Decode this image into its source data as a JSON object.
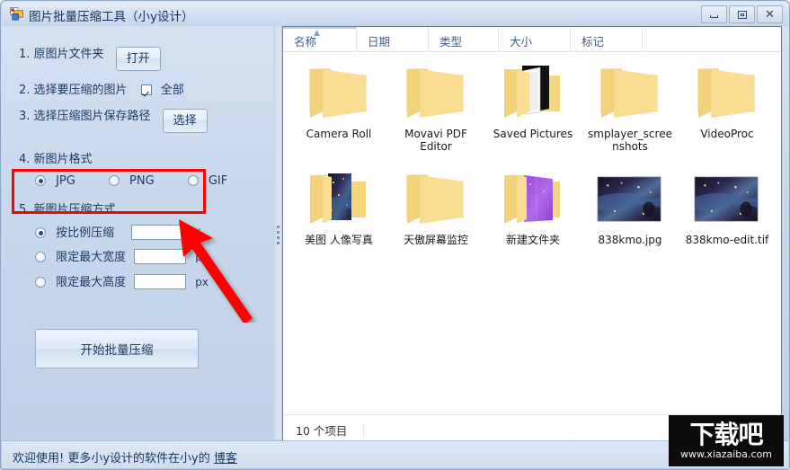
{
  "window": {
    "title": "图片批量压缩工具（小y设计）",
    "icon": "app-icon",
    "buttons": {
      "minimize": "minimize-icon",
      "maximize": "maximize-icon",
      "close": "close-icon"
    }
  },
  "left_panel": {
    "step1": {
      "label": "1. 原图片文件夹",
      "button": "打开"
    },
    "step2": {
      "label": "2. 选择要压缩的图片",
      "checkbox_label": "全部",
      "checked": true
    },
    "step3": {
      "label": "3. 选择压缩图片保存路径",
      "button": "选择"
    },
    "step4": {
      "label": "4. 新图片格式",
      "options": [
        {
          "label": "JPG",
          "selected": true
        },
        {
          "label": "PNG",
          "selected": false
        },
        {
          "label": "GIF",
          "selected": false
        }
      ]
    },
    "step5": {
      "label": "5. 新图片压缩方式",
      "options": [
        {
          "label": "按比例压缩",
          "selected": true,
          "value": "",
          "unit": "%"
        },
        {
          "label": "限定最大宽度",
          "selected": false,
          "value": "",
          "unit": "px"
        },
        {
          "label": "限定最大高度",
          "selected": false,
          "value": "",
          "unit": "px"
        }
      ]
    },
    "start_button": "开始批量压缩"
  },
  "annotation": {
    "box_color": "#ff0000",
    "arrow_color": "#ff0000"
  },
  "browser": {
    "columns": [
      {
        "label": "名称",
        "sorted": "asc"
      },
      {
        "label": "日期",
        "sorted": ""
      },
      {
        "label": "类型",
        "sorted": ""
      },
      {
        "label": "大小",
        "sorted": ""
      },
      {
        "label": "标记",
        "sorted": ""
      }
    ],
    "items": [
      {
        "name": "Camera Roll",
        "kind": "folder"
      },
      {
        "name": "Movavi PDF Editor",
        "kind": "folder"
      },
      {
        "name": "Saved Pictures",
        "kind": "folder-preview-doc"
      },
      {
        "name": "smplayer_screenshots",
        "kind": "folder"
      },
      {
        "name": "VideoProc",
        "kind": "folder"
      },
      {
        "name": "美图 人像写真",
        "kind": "folder-preview-photo"
      },
      {
        "name": "天傲屏幕监控",
        "kind": "folder"
      },
      {
        "name": "新建文件夹",
        "kind": "folder-preview-purple"
      },
      {
        "name": "838kmo.jpg",
        "kind": "image"
      },
      {
        "name": "838kmo-edit.tif",
        "kind": "image"
      }
    ],
    "status": "10 个项目"
  },
  "footer": {
    "text": "欢迎使用! 更多小y设计的软件在小y的 ",
    "link": "博客"
  },
  "watermark": {
    "title": "下载吧",
    "url": "www.xiazaiba.com"
  }
}
